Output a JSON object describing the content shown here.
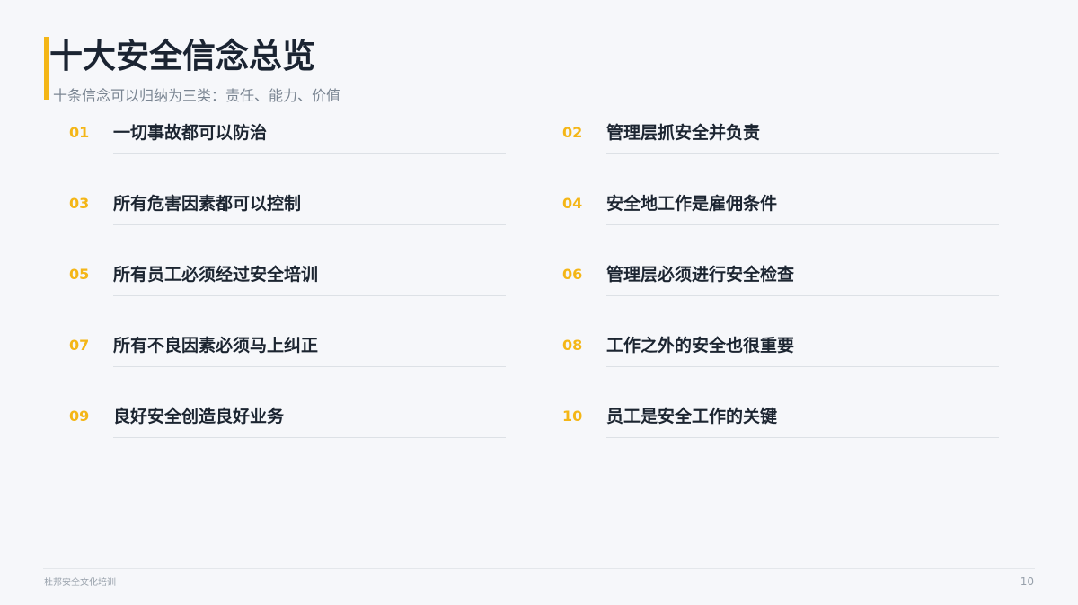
{
  "title": "十大安全信念总览",
  "subtitle": "十条信念可以归纳为三类：责任、能力、价值",
  "items": [
    {
      "num": "01",
      "text": "一切事故都可以防治"
    },
    {
      "num": "02",
      "text": "管理层抓安全并负责"
    },
    {
      "num": "03",
      "text": "所有危害因素都可以控制"
    },
    {
      "num": "04",
      "text": "安全地工作是雇佣条件"
    },
    {
      "num": "05",
      "text": "所有员工必须经过安全培训"
    },
    {
      "num": "06",
      "text": "管理层必须进行安全检查"
    },
    {
      "num": "07",
      "text": "所有不良因素必须马上纠正"
    },
    {
      "num": "08",
      "text": "工作之外的安全也很重要"
    },
    {
      "num": "09",
      "text": "良好安全创造良好业务"
    },
    {
      "num": "10",
      "text": "员工是安全工作的关键"
    }
  ],
  "footer": {
    "left": "杜邦安全文化培训",
    "page": "10"
  },
  "colors": {
    "accent": "#f4b617",
    "text": "#1c2531",
    "muted": "#7a8592",
    "background": "#f6f7fa"
  }
}
